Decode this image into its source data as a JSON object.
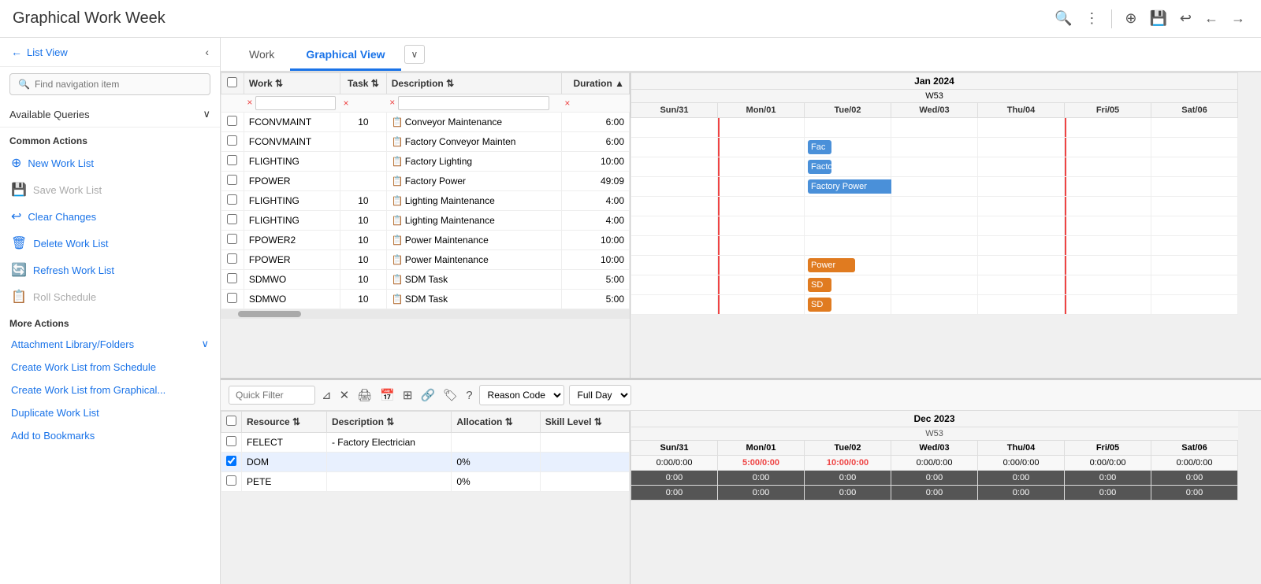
{
  "header": {
    "title": "Graphical Work Week",
    "search_icon": "🔍",
    "more_icon": "⋮",
    "add_icon": "⊕",
    "save_icon": "💾",
    "undo_icon": "↩",
    "back_icon": "←",
    "forward_icon": "→"
  },
  "sidebar": {
    "back_label": "List View",
    "search_placeholder": "Find navigation item",
    "queries_label": "Available Queries",
    "common_actions_label": "Common Actions",
    "more_actions_label": "More Actions",
    "actions": [
      {
        "id": "new-work-list",
        "label": "New Work List",
        "icon": "⊕",
        "enabled": true
      },
      {
        "id": "save-work-list",
        "label": "Save Work List",
        "icon": "💾",
        "enabled": false
      },
      {
        "id": "clear-changes",
        "label": "Clear Changes",
        "icon": "↩",
        "enabled": true
      },
      {
        "id": "delete-work-list",
        "label": "Delete Work List",
        "icon": "🗑",
        "enabled": true
      },
      {
        "id": "refresh-work-list",
        "label": "Refresh Work List",
        "icon": "🔄",
        "enabled": true
      },
      {
        "id": "roll-schedule",
        "label": "Roll Schedule",
        "icon": "📋",
        "enabled": false
      }
    ],
    "more_actions": [
      {
        "id": "attachment-library",
        "label": "Attachment Library/Folders",
        "has_expand": true
      },
      {
        "id": "create-from-schedule",
        "label": "Create Work List from Schedule",
        "has_expand": false
      },
      {
        "id": "create-from-graphical",
        "label": "Create Work List from Graphical...",
        "has_expand": false
      },
      {
        "id": "duplicate-work-list",
        "label": "Duplicate Work List",
        "has_expand": false
      },
      {
        "id": "add-to-bookmarks",
        "label": "Add to Bookmarks",
        "has_expand": false
      }
    ]
  },
  "tabs": [
    {
      "id": "work",
      "label": "Work"
    },
    {
      "id": "graphical-view",
      "label": "Graphical View",
      "active": true
    }
  ],
  "work_table": {
    "columns": [
      "",
      "Work",
      "Task",
      "Description",
      "Duration"
    ],
    "filter_row": [
      "×",
      "×",
      "×",
      "×"
    ],
    "rows": [
      {
        "check": false,
        "work": "FCONVMAINT",
        "task": "10",
        "icon": "📋",
        "desc": "Conveyor Maintenance",
        "duration": "6:00"
      },
      {
        "check": false,
        "work": "FCONVMAINT",
        "task": "",
        "icon": "📋",
        "desc": "Factory Conveyor Mainten",
        "duration": "6:00"
      },
      {
        "check": false,
        "work": "FLIGHTING",
        "task": "",
        "icon": "📋",
        "desc": "Factory Lighting",
        "duration": "10:00"
      },
      {
        "check": false,
        "work": "FPOWER",
        "task": "",
        "icon": "📋",
        "desc": "Factory Power",
        "duration": "49:09"
      },
      {
        "check": false,
        "work": "FLIGHTING",
        "task": "10",
        "icon": "📋",
        "desc": "Lighting Maintenance",
        "duration": "4:00"
      },
      {
        "check": false,
        "work": "FLIGHTING",
        "task": "10",
        "icon": "📋",
        "desc": "Lighting Maintenance",
        "duration": "4:00"
      },
      {
        "check": false,
        "work": "FPOWER2",
        "task": "10",
        "icon": "📋",
        "desc": "Power Maintenance",
        "duration": "10:00"
      },
      {
        "check": false,
        "work": "FPOWER",
        "task": "10",
        "icon": "📋",
        "desc": "Power Maintenance",
        "duration": "10:00"
      },
      {
        "check": false,
        "work": "SDMWO",
        "task": "10",
        "icon": "📋",
        "desc": "SDM Task",
        "duration": "5:00"
      },
      {
        "check": false,
        "work": "SDMWO",
        "task": "10",
        "icon": "📋",
        "desc": "SDM Task",
        "duration": "5:00"
      }
    ]
  },
  "gantt_top": {
    "month": "Jan 2024",
    "week": "W53",
    "days": [
      "Sun/31",
      "Mon/01",
      "Tue/02",
      "Wed/03",
      "Thu/04",
      "Fri/05",
      "Sat/06"
    ],
    "bars": [
      {
        "row": 1,
        "day_start": 2,
        "label": "Fac",
        "color": "blue",
        "width_pct": 30
      },
      {
        "row": 2,
        "day_start": 2,
        "label": "Factor",
        "color": "blue",
        "width_pct": 30
      },
      {
        "row": 3,
        "day_start": 2,
        "label": "Factory Power",
        "color": "blue",
        "width_pct": 200
      },
      {
        "row": 7,
        "day_start": 2,
        "label": "Power",
        "color": "orange",
        "width_pct": 60
      },
      {
        "row": 8,
        "day_start": 2,
        "label": "SD",
        "color": "orange",
        "width_pct": 30
      },
      {
        "row": 9,
        "day_start": 2,
        "label": "SD",
        "color": "orange",
        "width_pct": 30
      }
    ]
  },
  "bottom_toolbar": {
    "quick_filter_placeholder": "Quick Filter",
    "reason_code_label": "Reason Code",
    "full_day_label": "Full Day",
    "reason_code_options": [
      "Reason Code"
    ],
    "full_day_options": [
      "Full Day"
    ]
  },
  "resource_table": {
    "columns": [
      "",
      "Resource",
      "Description",
      "Allocation",
      "Skill Level"
    ],
    "rows": [
      {
        "check": false,
        "resource": "FELECT",
        "desc": "- Factory Electrician",
        "alloc": "",
        "skill": "",
        "is_group": true
      },
      {
        "check": true,
        "resource": "DOM",
        "desc": "",
        "alloc": "0%",
        "skill": "",
        "selected": true
      },
      {
        "check": false,
        "resource": "PETE",
        "desc": "",
        "alloc": "0%",
        "skill": ""
      }
    ]
  },
  "gantt_bottom": {
    "month": "Dec 2023",
    "week": "W53",
    "days": [
      "Sun/31",
      "Mon/01",
      "Tue/02",
      "Wed/03",
      "Thu/04",
      "Fri/05",
      "Sat/06"
    ],
    "felect_row": [
      "0:00/0:00",
      "5:00/0:00",
      "10:00/0:00",
      "0:00/0:00",
      "0:00/0:00",
      "0:00/0:00",
      "0:00/0:00"
    ],
    "dom_row": [
      "0:00",
      "0:00",
      "0:00",
      "0:00",
      "0:00",
      "0:00",
      "0:00"
    ],
    "pete_row": [
      "0:00",
      "0:00",
      "0:00",
      "0:00",
      "0:00",
      "0:00",
      "0:00"
    ],
    "felect_colors": [
      "normal",
      "red",
      "red",
      "normal",
      "normal",
      "normal",
      "normal"
    ]
  }
}
